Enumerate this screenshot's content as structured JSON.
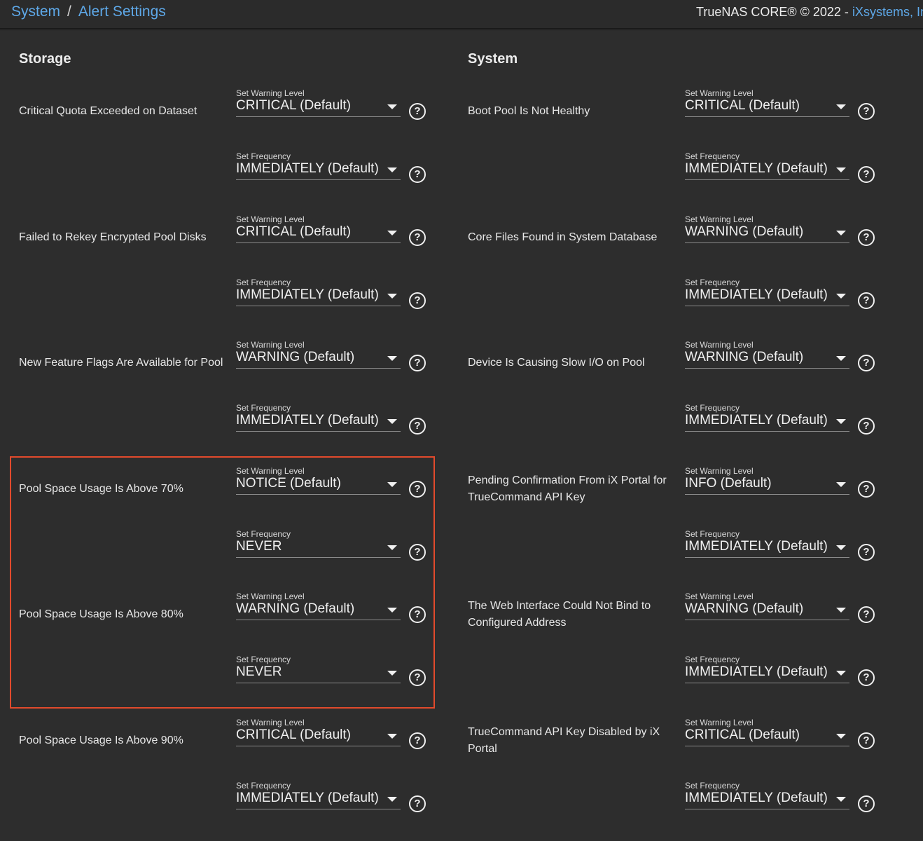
{
  "breadcrumb": {
    "root": "System",
    "current": "Alert Settings"
  },
  "copyright": {
    "text": "TrueNAS CORE® © 2022 - ",
    "vendor": "iXsystems, Inc"
  },
  "columns": {
    "storage_title": "Storage",
    "system_title": "System"
  },
  "labels": {
    "level": "Set Warning Level",
    "frequency": "Set Frequency",
    "help": "?"
  },
  "storage": [
    {
      "name": "Critical Quota Exceeded on Dataset",
      "level": "CRITICAL (Default)",
      "frequency": "IMMEDIATELY (Default)"
    },
    {
      "name": "Failed to Rekey Encrypted Pool Disks",
      "level": "CRITICAL (Default)",
      "frequency": "IMMEDIATELY (Default)"
    },
    {
      "name": "New Feature Flags Are Available for Pool",
      "level": "WARNING (Default)",
      "frequency": "IMMEDIATELY (Default)"
    },
    {
      "name": "Pool Space Usage Is Above 70%",
      "level": "NOTICE (Default)",
      "frequency": "NEVER"
    },
    {
      "name": "Pool Space Usage Is Above 80%",
      "level": "WARNING (Default)",
      "frequency": "NEVER"
    },
    {
      "name": "Pool Space Usage Is Above 90%",
      "level": "CRITICAL (Default)",
      "frequency": "IMMEDIATELY (Default)"
    }
  ],
  "system": [
    {
      "name": "Boot Pool Is Not Healthy",
      "level": "CRITICAL (Default)",
      "frequency": "IMMEDIATELY (Default)"
    },
    {
      "name": "Core Files Found in System Database",
      "level": "WARNING (Default)",
      "frequency": "IMMEDIATELY (Default)"
    },
    {
      "name": "Device Is Causing Slow I/O on Pool",
      "level": "WARNING (Default)",
      "frequency": "IMMEDIATELY (Default)"
    },
    {
      "name": "Pending Confirmation From iX Portal for TrueCommand API Key",
      "level": "INFO (Default)",
      "frequency": "IMMEDIATELY (Default)"
    },
    {
      "name": "The Web Interface Could Not Bind to Configured Address",
      "level": "WARNING (Default)",
      "frequency": "IMMEDIATELY (Default)"
    },
    {
      "name": "TrueCommand API Key Disabled by iX Portal",
      "level": "CRITICAL (Default)",
      "frequency": "IMMEDIATELY (Default)"
    }
  ],
  "highlight_color": "#e24a2c",
  "link_color": "#5ea8e8"
}
